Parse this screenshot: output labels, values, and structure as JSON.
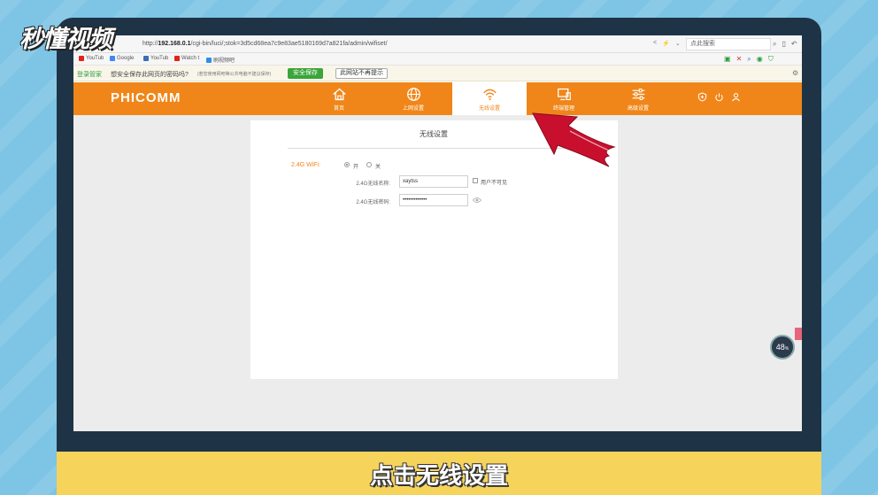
{
  "watermark": "秒懂视频",
  "browser": {
    "url_prefix": "http://",
    "url_host": "192.168.0.1",
    "url_path": "/cgi-bin/luci/;stok=3d5cd68ea7c9e83ae5180169d7a821fa/admin/wifiset/",
    "search_placeholder": "点此搜索",
    "bookmarks": [
      "YouTub",
      "Google",
      "YouTub",
      "Watch t",
      "刷视频吧"
    ]
  },
  "password_bar": {
    "login_label": "登录管家",
    "question": "想安全保存此网页的密码吗?",
    "hint": "(若您使用网吧等公共电脑不建议保存)",
    "save_button": "安全保存",
    "never_button": "此网站不再提示"
  },
  "router": {
    "brand": "PHICOMM",
    "nav": [
      {
        "label": "首页",
        "icon": "home-icon"
      },
      {
        "label": "上网设置",
        "icon": "globe-icon"
      },
      {
        "label": "无线设置",
        "icon": "wifi-icon",
        "active": true
      },
      {
        "label": "终端管理",
        "icon": "monitor-icon"
      },
      {
        "label": "高级设置",
        "icon": "sliders-icon"
      }
    ],
    "right_icons": [
      "shield-icon",
      "power-icon",
      "user-icon"
    ]
  },
  "wireless": {
    "title": "无线设置",
    "wifi_label": "2.4G WiFi:",
    "on_label": "开",
    "off_label": "关",
    "ssid_label": "2.4G无线名称:",
    "ssid_value": "xaytss",
    "hide_label": "用户不可见",
    "password_label": "2.4G无线密码:",
    "password_value": "•••••••••••••"
  },
  "badge": {
    "value": "48",
    "unit": "%"
  },
  "subtitle": "点击无线设置",
  "colors": {
    "router_orange": "#f08619",
    "save_green": "#3aa53a",
    "frame_dark": "#1e3446",
    "subtitle_yellow": "#f6d45c",
    "arrow_red": "#c8102e"
  }
}
